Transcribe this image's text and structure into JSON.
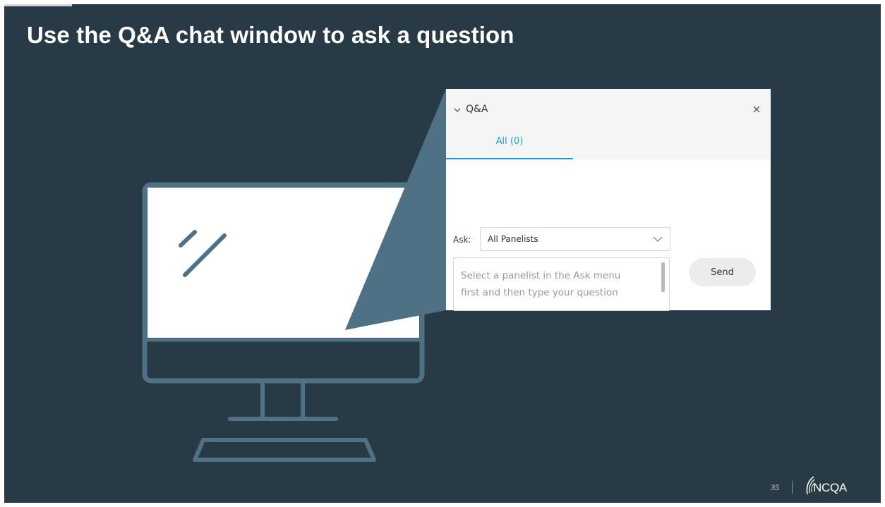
{
  "slide": {
    "title": "Use the Q&A chat window to ask a question",
    "page_number": "35",
    "logo_text": "NCQA",
    "colors": {
      "background": "#283a45",
      "illustration": "#4f7186",
      "accent": "#1a9fd8"
    }
  },
  "qa_panel": {
    "title": "Q&A",
    "collapse_icon": "chevron-down-icon",
    "close_icon": "close-icon",
    "tabs": [
      {
        "label": "All (0)",
        "selected": true
      }
    ],
    "ask_label": "Ask:",
    "ask_select": {
      "value": "All Panelists"
    },
    "question_placeholder": "Select a panelist in the Ask menu\nfirst and then type your question",
    "send_label": "Send"
  }
}
